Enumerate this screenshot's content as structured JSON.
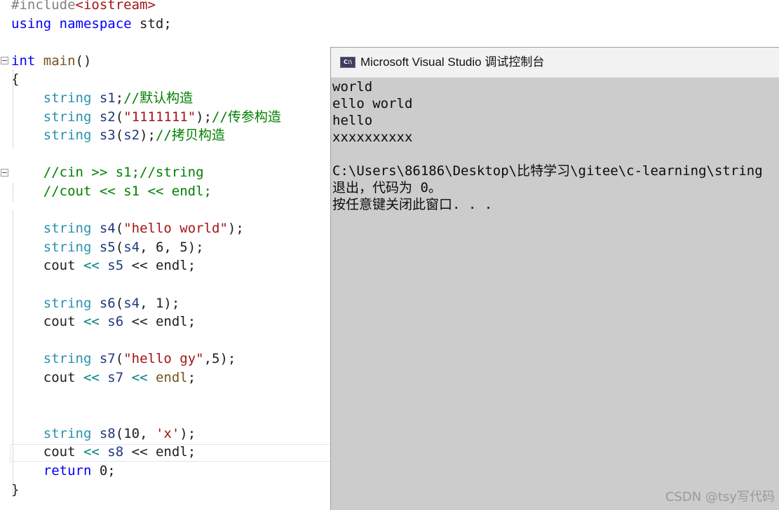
{
  "colors": {
    "keyword": "#0000ff",
    "type": "#2b91af",
    "identifier": "#1f377f",
    "string": "#a31515",
    "comment": "#008000",
    "operator": "#008080",
    "plain": "#1e1e1e",
    "preprocessor": "#808080",
    "function": "#74531f",
    "console_bg": "#cccccc"
  },
  "editor": {
    "lines": [
      {
        "tokens": [
          {
            "t": "#include",
            "c": "preprocessor"
          },
          {
            "t": "<iostream>",
            "c": "string"
          }
        ]
      },
      {
        "tokens": [
          {
            "t": "using",
            "c": "keyword"
          },
          {
            "t": " ",
            "c": "plain"
          },
          {
            "t": "namespace",
            "c": "keyword"
          },
          {
            "t": " std;",
            "c": "plain"
          }
        ]
      },
      {
        "tokens": []
      },
      {
        "tokens": [
          {
            "t": "int",
            "c": "keyword"
          },
          {
            "t": " ",
            "c": "plain"
          },
          {
            "t": "main",
            "c": "function"
          },
          {
            "t": "()",
            "c": "plain"
          }
        ]
      },
      {
        "tokens": [
          {
            "t": "{",
            "c": "plain"
          }
        ]
      },
      {
        "tokens": [
          {
            "t": "    ",
            "c": "plain"
          },
          {
            "t": "string",
            "c": "type"
          },
          {
            "t": " ",
            "c": "plain"
          },
          {
            "t": "s1",
            "c": "identifier"
          },
          {
            "t": ";",
            "c": "plain"
          },
          {
            "t": "//默认构造",
            "c": "comment"
          }
        ]
      },
      {
        "tokens": [
          {
            "t": "    ",
            "c": "plain"
          },
          {
            "t": "string",
            "c": "type"
          },
          {
            "t": " ",
            "c": "plain"
          },
          {
            "t": "s2",
            "c": "identifier"
          },
          {
            "t": "(",
            "c": "plain"
          },
          {
            "t": "\"1111111\"",
            "c": "string"
          },
          {
            "t": ");",
            "c": "plain"
          },
          {
            "t": "//传参构造",
            "c": "comment"
          }
        ]
      },
      {
        "tokens": [
          {
            "t": "    ",
            "c": "plain"
          },
          {
            "t": "string",
            "c": "type"
          },
          {
            "t": " ",
            "c": "plain"
          },
          {
            "t": "s3",
            "c": "identifier"
          },
          {
            "t": "(",
            "c": "plain"
          },
          {
            "t": "s2",
            "c": "identifier"
          },
          {
            "t": ");",
            "c": "plain"
          },
          {
            "t": "//拷贝构造",
            "c": "comment"
          }
        ]
      },
      {
        "tokens": []
      },
      {
        "tokens": [
          {
            "t": "    ",
            "c": "plain"
          },
          {
            "t": "//cin >> s1;//string",
            "c": "comment"
          }
        ]
      },
      {
        "tokens": [
          {
            "t": "    ",
            "c": "plain"
          },
          {
            "t": "//cout << s1 << endl;",
            "c": "comment"
          }
        ]
      },
      {
        "tokens": []
      },
      {
        "tokens": [
          {
            "t": "    ",
            "c": "plain"
          },
          {
            "t": "string",
            "c": "type"
          },
          {
            "t": " ",
            "c": "plain"
          },
          {
            "t": "s4",
            "c": "identifier"
          },
          {
            "t": "(",
            "c": "plain"
          },
          {
            "t": "\"hello world\"",
            "c": "string"
          },
          {
            "t": ");",
            "c": "plain"
          }
        ]
      },
      {
        "tokens": [
          {
            "t": "    ",
            "c": "plain"
          },
          {
            "t": "string",
            "c": "type"
          },
          {
            "t": " ",
            "c": "plain"
          },
          {
            "t": "s5",
            "c": "identifier"
          },
          {
            "t": "(",
            "c": "plain"
          },
          {
            "t": "s4",
            "c": "identifier"
          },
          {
            "t": ", 6, 5);",
            "c": "plain"
          }
        ]
      },
      {
        "tokens": [
          {
            "t": "    ",
            "c": "plain"
          },
          {
            "t": "cout",
            "c": "plain"
          },
          {
            "t": " << ",
            "c": "operator"
          },
          {
            "t": "s5",
            "c": "identifier"
          },
          {
            "t": " << endl;",
            "c": "plain"
          }
        ]
      },
      {
        "tokens": []
      },
      {
        "tokens": [
          {
            "t": "    ",
            "c": "plain"
          },
          {
            "t": "string",
            "c": "type"
          },
          {
            "t": " ",
            "c": "plain"
          },
          {
            "t": "s6",
            "c": "identifier"
          },
          {
            "t": "(",
            "c": "plain"
          },
          {
            "t": "s4",
            "c": "identifier"
          },
          {
            "t": ", 1);",
            "c": "plain"
          }
        ]
      },
      {
        "tokens": [
          {
            "t": "    ",
            "c": "plain"
          },
          {
            "t": "cout",
            "c": "plain"
          },
          {
            "t": " << ",
            "c": "operator"
          },
          {
            "t": "s6",
            "c": "identifier"
          },
          {
            "t": " << endl;",
            "c": "plain"
          }
        ]
      },
      {
        "tokens": []
      },
      {
        "tokens": [
          {
            "t": "    ",
            "c": "plain"
          },
          {
            "t": "string",
            "c": "type"
          },
          {
            "t": " ",
            "c": "plain"
          },
          {
            "t": "s7",
            "c": "identifier"
          },
          {
            "t": "(",
            "c": "plain"
          },
          {
            "t": "\"hello gy\"",
            "c": "string"
          },
          {
            "t": ",5);",
            "c": "plain"
          }
        ]
      },
      {
        "tokens": [
          {
            "t": "    ",
            "c": "plain"
          },
          {
            "t": "cout",
            "c": "plain"
          },
          {
            "t": " << ",
            "c": "operator"
          },
          {
            "t": "s7",
            "c": "identifier"
          },
          {
            "t": " << ",
            "c": "operator"
          },
          {
            "t": "endl",
            "c": "function"
          },
          {
            "t": ";",
            "c": "plain"
          }
        ]
      },
      {
        "tokens": []
      },
      {
        "tokens": []
      },
      {
        "tokens": [
          {
            "t": "    ",
            "c": "plain"
          },
          {
            "t": "string",
            "c": "type"
          },
          {
            "t": " ",
            "c": "plain"
          },
          {
            "t": "s8",
            "c": "identifier"
          },
          {
            "t": "(10, ",
            "c": "plain"
          },
          {
            "t": "'x'",
            "c": "string"
          },
          {
            "t": ");",
            "c": "plain"
          }
        ]
      },
      {
        "tokens": [
          {
            "t": "    ",
            "c": "plain"
          },
          {
            "t": "cout",
            "c": "plain"
          },
          {
            "t": " << ",
            "c": "operator"
          },
          {
            "t": "s8",
            "c": "identifier"
          },
          {
            "t": " << endl;",
            "c": "plain"
          }
        ]
      },
      {
        "tokens": [
          {
            "t": "    ",
            "c": "plain"
          },
          {
            "t": "return",
            "c": "keyword"
          },
          {
            "t": " 0;",
            "c": "plain"
          }
        ]
      },
      {
        "tokens": [
          {
            "t": "}",
            "c": "plain"
          }
        ]
      }
    ]
  },
  "console": {
    "title": "Microsoft Visual Studio 调试控制台",
    "icon_text": "C:\\",
    "lines": [
      "world",
      "ello world",
      "hello",
      "xxxxxxxxxx",
      "",
      "C:\\Users\\86186\\Desktop\\比特学习\\gitee\\c-learning\\string",
      "退出，代码为 0。",
      "按任意键关闭此窗口. . ."
    ]
  },
  "watermark": "CSDN @tsy写代码"
}
